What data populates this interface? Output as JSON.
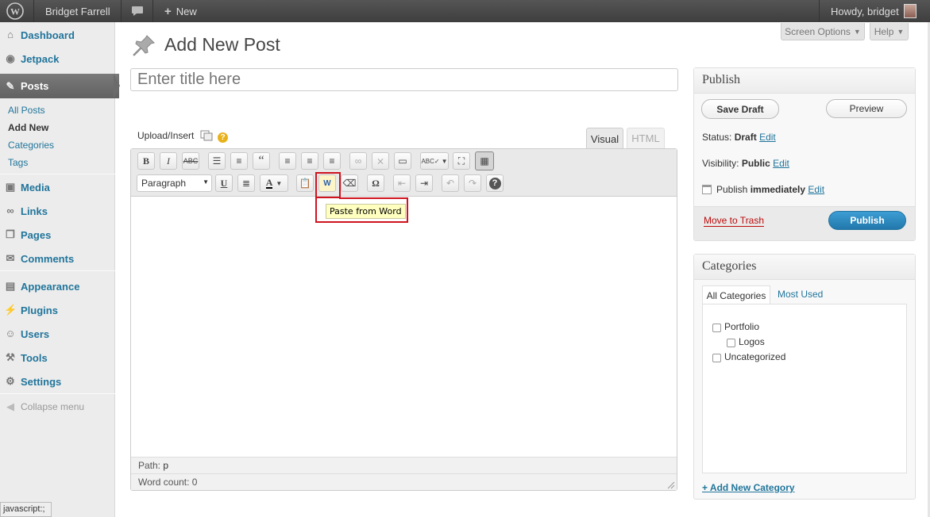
{
  "admin_bar": {
    "site_name": "Bridget Farrell",
    "new_label": "New",
    "howdy": "Howdy, bridget"
  },
  "sidebar": {
    "items": [
      {
        "label": "Dashboard",
        "icon": "dashboard-icon"
      },
      {
        "label": "Jetpack",
        "icon": "jetpack-icon"
      },
      {
        "label": "Posts",
        "icon": "pushpin-icon"
      },
      {
        "label": "Media",
        "icon": "media-icon"
      },
      {
        "label": "Links",
        "icon": "links-icon"
      },
      {
        "label": "Pages",
        "icon": "pages-icon"
      },
      {
        "label": "Comments",
        "icon": "comments-icon"
      },
      {
        "label": "Appearance",
        "icon": "appearance-icon"
      },
      {
        "label": "Plugins",
        "icon": "plugins-icon"
      },
      {
        "label": "Users",
        "icon": "users-icon"
      },
      {
        "label": "Tools",
        "icon": "tools-icon"
      },
      {
        "label": "Settings",
        "icon": "settings-icon"
      }
    ],
    "posts_submenu": [
      "All Posts",
      "Add New",
      "Categories",
      "Tags"
    ],
    "collapse": "Collapse menu"
  },
  "header": {
    "title": "Add New Post",
    "screen_options": "Screen Options",
    "help": "Help"
  },
  "editor": {
    "title_placeholder": "Enter title here",
    "upload_insert": "Upload/Insert",
    "tab_visual": "Visual",
    "tab_html": "HTML",
    "format_select": "Paragraph",
    "tooltip": "Paste from Word",
    "path_label": "Path:",
    "path_value": "p",
    "word_count": "Word count: 0"
  },
  "publish": {
    "title": "Publish",
    "save_draft": "Save Draft",
    "preview": "Preview",
    "status_label": "Status:",
    "status_value": "Draft",
    "visibility_label": "Visibility:",
    "visibility_value": "Public",
    "publish_label": "Publish",
    "publish_value": "immediately",
    "edit": "Edit",
    "trash": "Move to Trash",
    "publish_button": "Publish"
  },
  "categories": {
    "title": "Categories",
    "tab_all": "All Categories",
    "tab_most_used": "Most Used",
    "items": [
      "Portfolio",
      "Logos",
      "Uncategorized"
    ],
    "add_new": "+ Add New Category"
  },
  "status_bar": "javascript:;",
  "colors": {
    "link": "#21759b",
    "highlight": "#d0131e",
    "primary": "#2e8cc0"
  }
}
